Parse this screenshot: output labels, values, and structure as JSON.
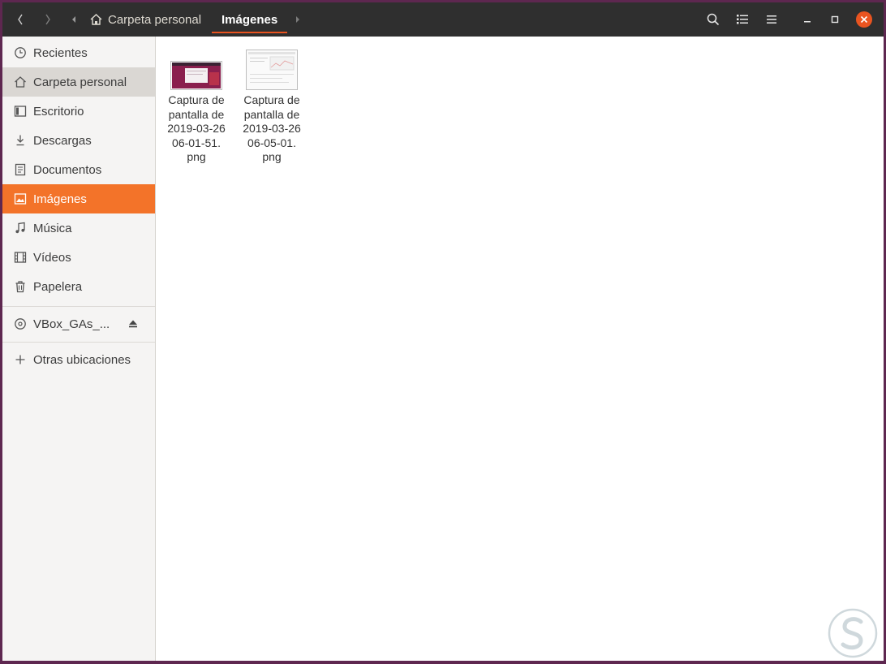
{
  "titlebar": {
    "back_icon": "chevron-left-icon",
    "forward_icon": "chevron-right-icon",
    "breadcrumb": [
      {
        "label": "Carpeta personal",
        "icon": "home-icon"
      },
      {
        "label": "Imágenes"
      }
    ],
    "actions": [
      "search-icon",
      "view-list-icon",
      "menu-icon"
    ],
    "window_controls": [
      "minimize-icon",
      "maximize-icon",
      "close-icon"
    ],
    "accent": "#e95420"
  },
  "sidebar": {
    "items": [
      {
        "label": "Recientes",
        "icon": "clock-icon"
      },
      {
        "label": "Carpeta personal",
        "icon": "home-icon"
      },
      {
        "label": "Escritorio",
        "icon": "desktop-icon"
      },
      {
        "label": "Descargas",
        "icon": "download-icon"
      },
      {
        "label": "Documentos",
        "icon": "document-icon"
      },
      {
        "label": "Imágenes",
        "icon": "image-icon"
      },
      {
        "label": "Música",
        "icon": "music-icon"
      },
      {
        "label": "Vídeos",
        "icon": "video-icon"
      },
      {
        "label": "Papelera",
        "icon": "trash-icon"
      }
    ],
    "device": {
      "label": "VBox_GAs_...",
      "icon": "disc-icon",
      "eject_icon": "eject-icon"
    },
    "other": {
      "label": "Otras ubicaciones",
      "icon": "plus-icon"
    },
    "active_color": "#f37329"
  },
  "files": [
    {
      "lines": [
        "Captura de",
        "pantalla de",
        "2019-03-26",
        "06-01-51.",
        "png"
      ]
    },
    {
      "lines": [
        "Captura de",
        "pantalla de",
        "2019-03-26",
        "06-05-01.",
        "png"
      ]
    }
  ]
}
